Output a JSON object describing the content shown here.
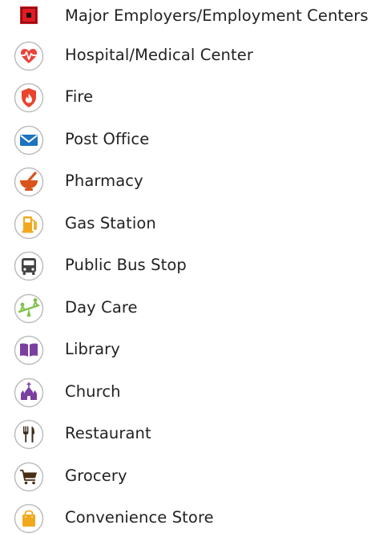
{
  "legend": {
    "items": [
      {
        "label": "Major Employers/Employment Centers",
        "icon": "major-employer-icon",
        "color": "#e31b23"
      },
      {
        "label": "Hospital/Medical Center",
        "icon": "hospital-heartbeat-icon",
        "color": "#e8453c"
      },
      {
        "label": "Fire",
        "icon": "fire-shield-icon",
        "color": "#e8452c"
      },
      {
        "label": "Post Office",
        "icon": "envelope-icon",
        "color": "#1e73be"
      },
      {
        "label": "Pharmacy",
        "icon": "mortar-pestle-icon",
        "color": "#d9541c"
      },
      {
        "label": "Gas Station",
        "icon": "gas-pump-icon",
        "color": "#f2a81d"
      },
      {
        "label": "Public Bus Stop",
        "icon": "bus-icon",
        "color": "#444444"
      },
      {
        "label": "Day Care",
        "icon": "seesaw-icon",
        "color": "#7cc24a"
      },
      {
        "label": "Library",
        "icon": "book-icon",
        "color": "#7b3fa0"
      },
      {
        "label": "Church",
        "icon": "church-icon",
        "color": "#7b3fa0"
      },
      {
        "label": "Restaurant",
        "icon": "fork-knife-icon",
        "color": "#3a2a1a"
      },
      {
        "label": "Grocery",
        "icon": "shopping-cart-icon",
        "color": "#4a2e14"
      },
      {
        "label": "Convenience Store",
        "icon": "shopping-bag-icon",
        "color": "#f2a81d"
      }
    ]
  }
}
